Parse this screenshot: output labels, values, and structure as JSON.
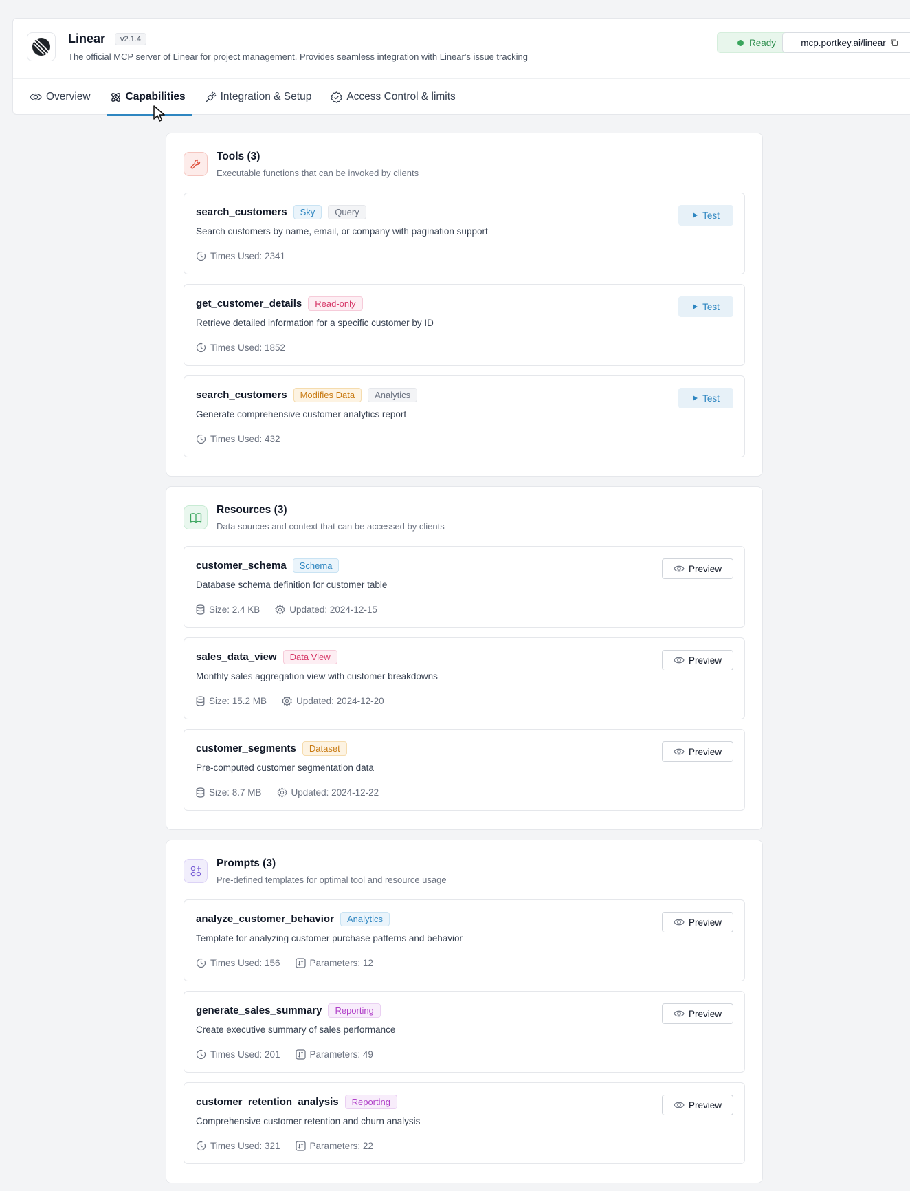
{
  "header": {
    "app_name": "Linear",
    "version": "v2.1.4",
    "description": "The official MCP server of Linear for project management. Provides seamless integration with Linear's issue tracking",
    "status": "Ready",
    "endpoint": "mcp.portkey.ai/linear"
  },
  "tabs": [
    {
      "label": "Overview",
      "icon": "eye-icon"
    },
    {
      "label": "Capabilities",
      "icon": "atom-icon",
      "active": true
    },
    {
      "label": "Integration & Setup",
      "icon": "plug-icon"
    },
    {
      "label": "Access Control & limits",
      "icon": "check-badge-icon"
    }
  ],
  "tools": {
    "title": "Tools (3)",
    "subtitle": "Executable functions that can be invoked by clients",
    "action_label": "Test",
    "items": [
      {
        "name": "search_customers",
        "badges": [
          "Sky",
          "Query"
        ],
        "description": "Search customers by name, email, or company with pagination support",
        "times_used": "Times Used: 2341"
      },
      {
        "name": "get_customer_details",
        "badges": [
          "Read-only"
        ],
        "description": "Retrieve detailed information for a specific customer by ID",
        "times_used": "Times Used: 1852"
      },
      {
        "name": "search_customers",
        "badges": [
          "Modifies Data",
          "Analytics"
        ],
        "description": "Generate comprehensive customer analytics report",
        "times_used": "Times Used: 432"
      }
    ]
  },
  "resources": {
    "title": "Resources (3)",
    "subtitle": "Data sources and context that can be accessed by clients",
    "action_label": "Preview",
    "items": [
      {
        "name": "customer_schema",
        "badges": [
          "Schema"
        ],
        "description": "Database schema definition for customer table",
        "size": "Size: 2.4 KB",
        "updated": "Updated: 2024-12-15"
      },
      {
        "name": "sales_data_view",
        "badges": [
          "Data View"
        ],
        "description": "Monthly sales aggregation view with customer breakdowns",
        "size": "Size: 15.2 MB",
        "updated": "Updated: 2024-12-20"
      },
      {
        "name": "customer_segments",
        "badges": [
          "Dataset"
        ],
        "description": "Pre-computed customer segmentation data",
        "size": "Size: 8.7 MB",
        "updated": "Updated: 2024-12-22"
      }
    ]
  },
  "prompts": {
    "title": "Prompts (3)",
    "subtitle": "Pre-defined templates for optimal tool and resource usage",
    "action_label": "Preview",
    "items": [
      {
        "name": "analyze_customer_behavior",
        "badges": [
          "Analytics"
        ],
        "description": "Template for analyzing customer purchase patterns and behavior",
        "times_used": "Times Used: 156",
        "parameters": "Parameters: 12"
      },
      {
        "name": "generate_sales_summary",
        "badges": [
          "Reporting"
        ],
        "description": "Create executive summary of sales performance",
        "times_used": "Times Used: 201",
        "parameters": "Parameters: 49"
      },
      {
        "name": "customer_retention_analysis",
        "badges": [
          "Reporting"
        ],
        "description": "Comprehensive customer retention and churn analysis",
        "times_used": "Times Used: 321",
        "parameters": "Parameters: 22"
      }
    ]
  },
  "colors": {
    "accent": "#2e86c1",
    "ready": "#3aa55d",
    "tools_icon": "#e0533f",
    "resources_icon": "#3aa55d",
    "prompts_icon": "#7b61d6"
  }
}
